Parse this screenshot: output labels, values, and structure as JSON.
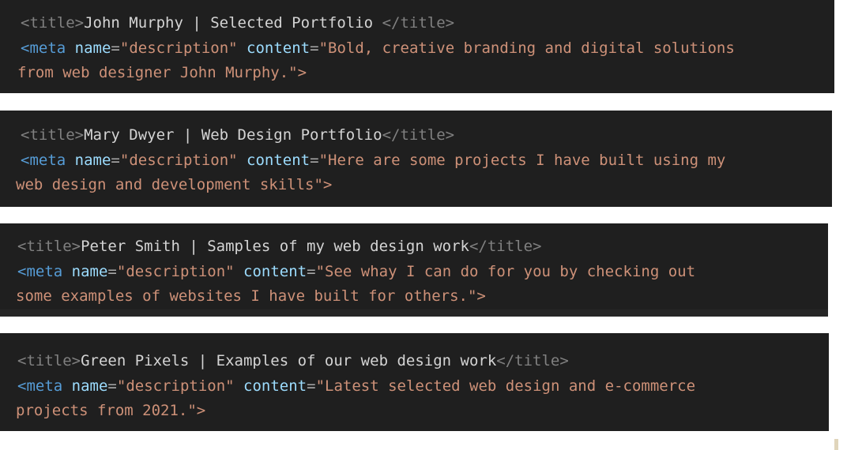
{
  "page": {
    "background_color": "#ffffff",
    "block_background_color": "#1f1f1f",
    "artifact_color": "#e0d5bb"
  },
  "theme": {
    "punct_color": "#808080",
    "tag_color": "#569cd6",
    "attr_color": "#9cdcfe",
    "equals_color": "#a9a9a9",
    "string_color": "#ce9178",
    "text_color": "#d4d4d4"
  },
  "blocks": [
    {
      "id": "block-1",
      "title_open": "<title>",
      "title_text": "John Murphy | Selected Portfolio ",
      "title_close": "</title>",
      "meta_open": "<meta",
      "meta_attr_name": "name",
      "meta_eq1": "=",
      "meta_name_value": "\"description\"",
      "meta_attr_content": "content",
      "meta_eq2": "=",
      "meta_content_line1": "\"Bold, creative branding and digital solutions",
      "meta_content_line2": "from web designer John Murphy.\">"
    },
    {
      "id": "block-2",
      "title_open": "<title>",
      "title_text": "Mary Dwyer | Web Design Portfolio",
      "title_close": "</title>",
      "meta_open": "<meta",
      "meta_attr_name": "name",
      "meta_eq1": "=",
      "meta_name_value": "\"description\"",
      "meta_attr_content": "content",
      "meta_eq2": "=",
      "meta_content_line1": "\"Here are some projects I have built using my",
      "meta_content_line2": "web design and development skills\">"
    },
    {
      "id": "block-3",
      "title_open": "<title>",
      "title_text": "Peter Smith | Samples of my web design work",
      "title_close": "</title>",
      "meta_open": "<meta",
      "meta_attr_name": "name",
      "meta_eq1": "=",
      "meta_name_value": "\"description\"",
      "meta_attr_content": "content",
      "meta_eq2": "=",
      "meta_content_line1": "\"See whay I can do for you by checking out",
      "meta_content_line2": "some examples of websites I have built for others.\">"
    },
    {
      "id": "block-4",
      "title_open": "<title>",
      "title_text": "Green Pixels | Examples of our web design work",
      "title_close": "</title>",
      "meta_open": "<meta",
      "meta_attr_name": "name",
      "meta_eq1": "=",
      "meta_name_value": "\"description\"",
      "meta_attr_content": "content",
      "meta_eq2": "=",
      "meta_content_line1": "\"Latest selected web design and e-commerce",
      "meta_content_line2": "projects from 2021.\">"
    }
  ]
}
